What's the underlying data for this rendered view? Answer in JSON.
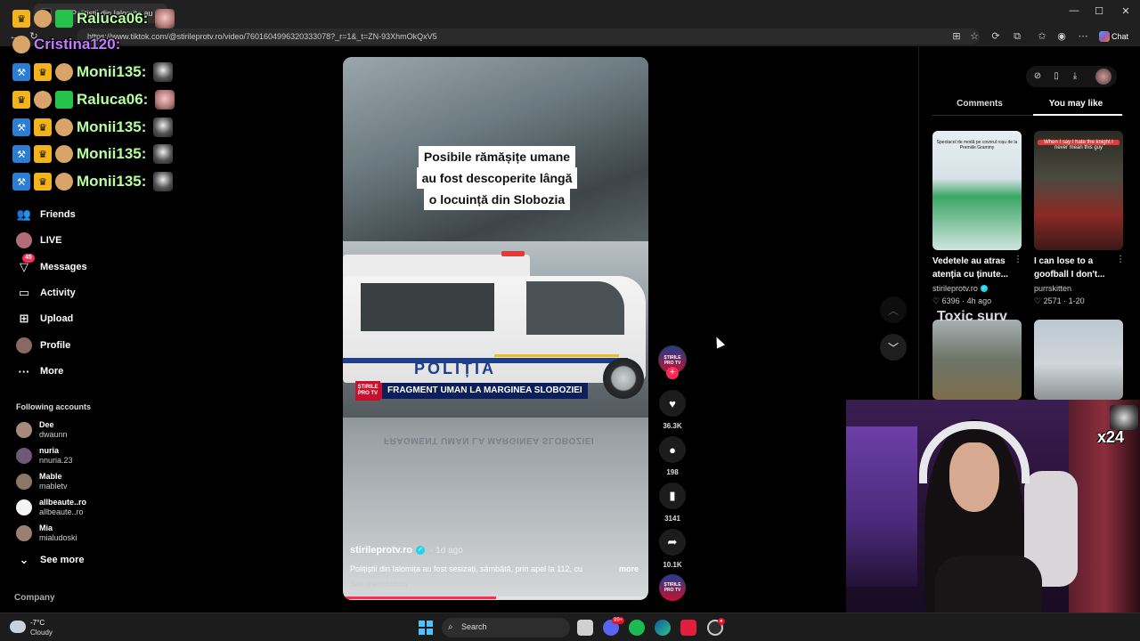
{
  "browser": {
    "tab_title": "(45)Polițiștii din Ialomița au f",
    "url": "https://www.tiktok.com/@stirileprotv.ro/video/7601604996320333078?_r=1&_t=ZN-93XhmOkQxV5",
    "chat_label": "Chat",
    "minimize": "—",
    "maximize": "☐",
    "close": "✕"
  },
  "sidebar": {
    "items": [
      {
        "label": "Friends",
        "icon": "friends-icon"
      },
      {
        "label": "LIVE",
        "icon": "live-icon"
      },
      {
        "label": "Messages",
        "icon": "messages-icon",
        "badge": "45"
      },
      {
        "label": "Activity",
        "icon": "activity-icon"
      },
      {
        "label": "Upload",
        "icon": "upload-icon"
      },
      {
        "label": "Profile",
        "icon": "profile-icon"
      },
      {
        "label": "More",
        "icon": "more-icon"
      }
    ],
    "following_title": "Following accounts",
    "accounts": [
      {
        "name": "Dee",
        "handle": "dwaunn",
        "color": "#a88a7c"
      },
      {
        "name": "nuria",
        "handle": "nnuria.23",
        "color": "#6d5a78"
      },
      {
        "name": "Mable",
        "handle": "mabletv",
        "color": "#8b7766"
      },
      {
        "name": "allbeaute..ro",
        "handle": "allbeaute..ro",
        "color": "#f4f4f4"
      },
      {
        "name": "Mia",
        "handle": "mialudoski",
        "color": "#9c7f6e"
      }
    ],
    "see_more": "See more",
    "company": "Company"
  },
  "chat_overlay": [
    {
      "user": "Raluca06:",
      "color": "green"
    },
    {
      "user": "Cristina120:",
      "color": "purple"
    },
    {
      "user": "Monii135:",
      "color": "green"
    },
    {
      "user": "Raluca06:",
      "color": "green"
    },
    {
      "user": "Monii135:",
      "color": "green"
    },
    {
      "user": "Monii135:",
      "color": "green"
    },
    {
      "user": "Monii135:",
      "color": "green"
    }
  ],
  "video": {
    "caption_lines": [
      "Posibile rămășițe umane",
      "au fost descoperite lângă",
      "o locuință din Slobozia"
    ],
    "van_text": "POLIȚIA",
    "lower_third_logo": "ȘTIRILE PRO TV",
    "lower_third": "FRAGMENT UMAN LA MARGINEA SLOBOZIEI",
    "author": "stirileprotv.ro",
    "date": "· 1d ago",
    "description": "Polițiștii din Ialomița au fost sesizați, sâmbătă, prin apel la 112, cu",
    "more": "more",
    "see_translation": "See translation",
    "progress": 0.5
  },
  "rail": {
    "avatar_text": "ȘTIRILE PRO TV",
    "likes": "36.3K",
    "comments": "198",
    "saves": "3141",
    "shares": "10.1K"
  },
  "right_panel": {
    "tab_comments": "Comments",
    "tab_you_may_like": "You may like",
    "recommendations": [
      {
        "thumb_text": "Spectacol de modă pe covorul roșu de la Premiile Grammy",
        "title": "Vedetele au atras atenția cu ținute...",
        "author": "stirileprotv.ro",
        "stats": "♡ 6396 · 4h ago",
        "verified": true
      },
      {
        "thumb_text": "When I say I hate the knight I never mean this guy",
        "title": "I can lose to a goofball I don't...",
        "author": "purrskitten",
        "stats": "♡ 2571 · 1-20",
        "verified": false
      }
    ],
    "overlay_text": "Toxic surv"
  },
  "webcam": {
    "counter": "x24"
  },
  "taskbar": {
    "temp": "-7°C",
    "condition": "Cloudy",
    "search": "Search",
    "discord_badge": "99+"
  }
}
